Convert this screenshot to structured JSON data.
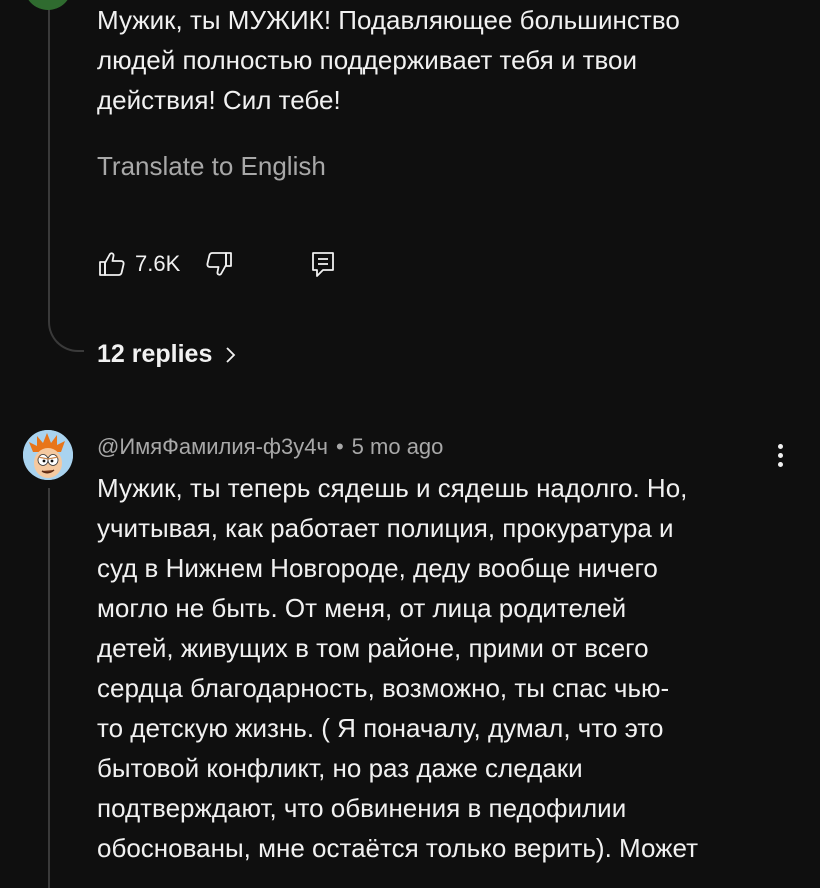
{
  "comment1": {
    "text": "Мужик, ты МУЖИК! Подавляющее большинство\nлюдей полностью поддерживает тебя и твои\nдействия! Сил тебе!",
    "translate_label": "Translate to English",
    "like_count": "7.6K",
    "replies_label": "12 replies",
    "avatar_color": "#2f6b2f"
  },
  "comment2": {
    "author": "@ИмяФамилия-ф3у4ч",
    "separator": "•",
    "time": "5 mo ago",
    "text": "Мужик, ты теперь сядешь и сядешь надолго. Но,\nучитывая, как работает полиция, прокуратура и\nсуд в Нижнем Новгороде, деду вообще ничего\nмогло не быть. От меня, от лица родителей\nдетей, живущих в том районе, прими от всего\nсердца благодарность, возможно, ты  спас чью-\nто детскую жизнь. ( Я поначалу, думал, что это\nбытовой конфликт, но раз даже следаки\nподтверждают, что обвинения в педофилии\nобоснованы, мне остаётся только верить). Может"
  },
  "icons": {
    "like": "thumbs-up-icon",
    "dislike": "thumbs-down-icon",
    "reply": "reply-icon",
    "more": "more-vert-icon",
    "chevron": "chevron-right-icon"
  },
  "colors": {
    "background": "#0f0f0f",
    "text_primary": "#f1f1f1",
    "text_secondary": "#a8a8a8",
    "thread_line": "#3a3a3a"
  }
}
